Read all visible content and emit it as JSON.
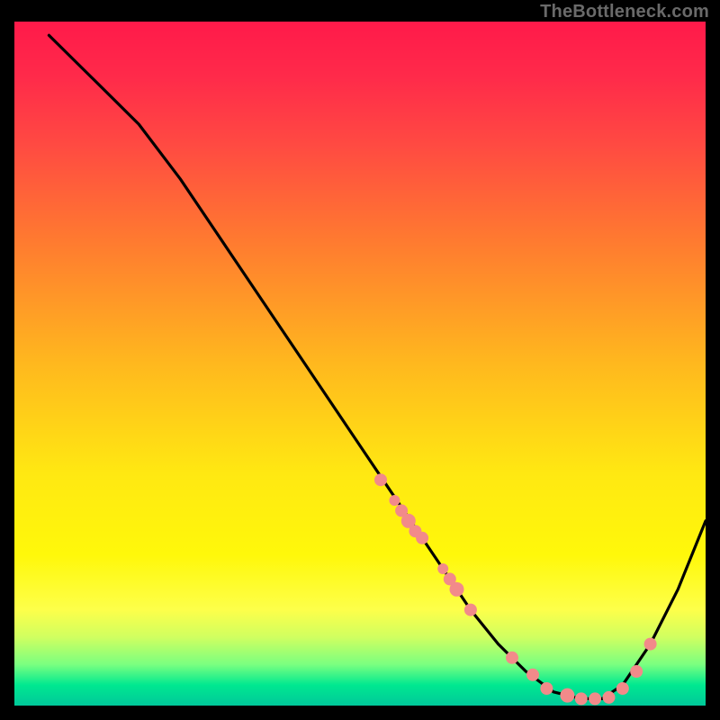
{
  "watermark": "TheBottleneck.com",
  "chart_data": {
    "type": "line",
    "title": "",
    "xlabel": "",
    "ylabel": "",
    "xlim": [
      0,
      100
    ],
    "ylim": [
      0,
      100
    ],
    "series": [
      {
        "name": "curve",
        "x": [
          5,
          8,
          12,
          18,
          24,
          30,
          36,
          42,
          48,
          54,
          58,
          62,
          66,
          70,
          74,
          78,
          82,
          85,
          88,
          92,
          96,
          100
        ],
        "y": [
          98,
          95,
          91,
          85,
          77,
          68,
          59,
          50,
          41,
          32,
          26,
          20,
          14,
          9,
          5,
          2,
          1,
          1,
          3,
          9,
          17,
          27
        ]
      }
    ],
    "markers": {
      "name": "points",
      "x": [
        53,
        55,
        56,
        57,
        58,
        59,
        62,
        63,
        64,
        66,
        72,
        75,
        77,
        80,
        82,
        84,
        86,
        88,
        90,
        92
      ],
      "y": [
        33,
        30,
        28.5,
        27,
        25.5,
        24.5,
        20,
        18.5,
        17,
        14,
        7,
        4.5,
        2.5,
        1.5,
        1,
        1,
        1.2,
        2.5,
        5,
        9
      ],
      "r": [
        7,
        6,
        7,
        8,
        7,
        7,
        6,
        7,
        8,
        7,
        7,
        7,
        7,
        8,
        7,
        7,
        7,
        7,
        7,
        7
      ]
    },
    "gradient_stops": [
      {
        "pos": 0,
        "color": "#ff1a4a"
      },
      {
        "pos": 18,
        "color": "#ff4a42"
      },
      {
        "pos": 50,
        "color": "#ffb81e"
      },
      {
        "pos": 78,
        "color": "#fff80a"
      },
      {
        "pos": 94,
        "color": "#7aff80"
      },
      {
        "pos": 100,
        "color": "#00c89a"
      }
    ]
  }
}
